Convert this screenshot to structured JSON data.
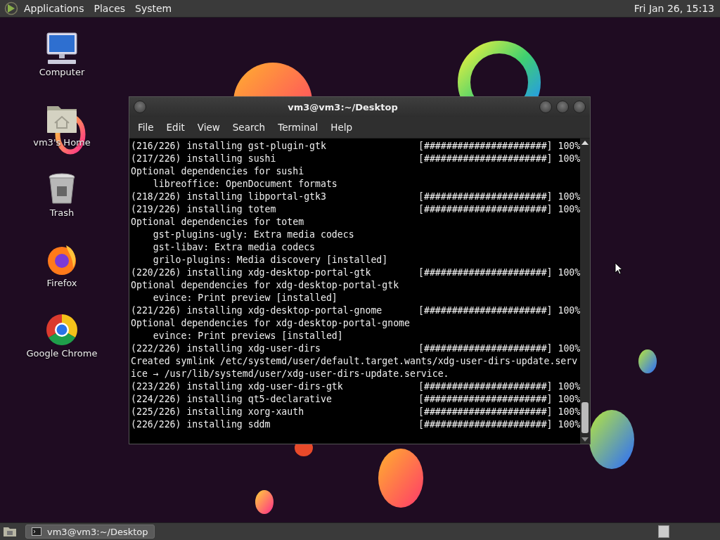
{
  "top_panel": {
    "menus": [
      "Applications",
      "Places",
      "System"
    ],
    "clock": "Fri Jan 26, 15:13"
  },
  "desktop_icons": [
    {
      "kind": "computer",
      "label": "Computer"
    },
    {
      "kind": "home",
      "label": "vm3's Home"
    },
    {
      "kind": "trash",
      "label": "Trash"
    },
    {
      "kind": "firefox",
      "label": "Firefox"
    },
    {
      "kind": "chrome",
      "label": "Google Chrome"
    }
  ],
  "terminal": {
    "title": "vm3@vm3:~/Desktop",
    "menus": [
      "File",
      "Edit",
      "View",
      "Search",
      "Terminal",
      "Help"
    ],
    "lines": [
      {
        "text": "(216/226) installing gst-plugin-gtk",
        "bar": "[######################] 100%"
      },
      {
        "text": "(217/226) installing sushi",
        "bar": "[######################] 100%"
      },
      {
        "text": "Optional dependencies for sushi"
      },
      {
        "text": "    libreoffice: OpenDocument formats"
      },
      {
        "text": "(218/226) installing libportal-gtk3",
        "bar": "[######################] 100%"
      },
      {
        "text": "(219/226) installing totem",
        "bar": "[######################] 100%"
      },
      {
        "text": "Optional dependencies for totem"
      },
      {
        "text": "    gst-plugins-ugly: Extra media codecs"
      },
      {
        "text": "    gst-libav: Extra media codecs"
      },
      {
        "text": "    grilo-plugins: Media discovery [installed]"
      },
      {
        "text": "(220/226) installing xdg-desktop-portal-gtk",
        "bar": "[######################] 100%"
      },
      {
        "text": "Optional dependencies for xdg-desktop-portal-gtk"
      },
      {
        "text": "    evince: Print preview [installed]"
      },
      {
        "text": "(221/226) installing xdg-desktop-portal-gnome",
        "bar": "[######################] 100%"
      },
      {
        "text": "Optional dependencies for xdg-desktop-portal-gnome"
      },
      {
        "text": "    evince: Print previews [installed]"
      },
      {
        "text": "(222/226) installing xdg-user-dirs",
        "bar": "[######################] 100%"
      },
      {
        "text": "Created symlink /etc/systemd/user/default.target.wants/xdg-user-dirs-update.serv"
      },
      {
        "text": "ice → /usr/lib/systemd/user/xdg-user-dirs-update.service."
      },
      {
        "text": "(223/226) installing xdg-user-dirs-gtk",
        "bar": "[######################] 100%"
      },
      {
        "text": "(224/226) installing qt5-declarative",
        "bar": "[######################] 100%"
      },
      {
        "text": "(225/226) installing xorg-xauth",
        "bar": "[######################] 100%"
      },
      {
        "text": "(226/226) installing sddm",
        "bar": "[######################] 100%"
      }
    ]
  },
  "taskbar": {
    "tasks": [
      {
        "label": "vm3@vm3:~/Desktop",
        "selected": true
      }
    ]
  }
}
